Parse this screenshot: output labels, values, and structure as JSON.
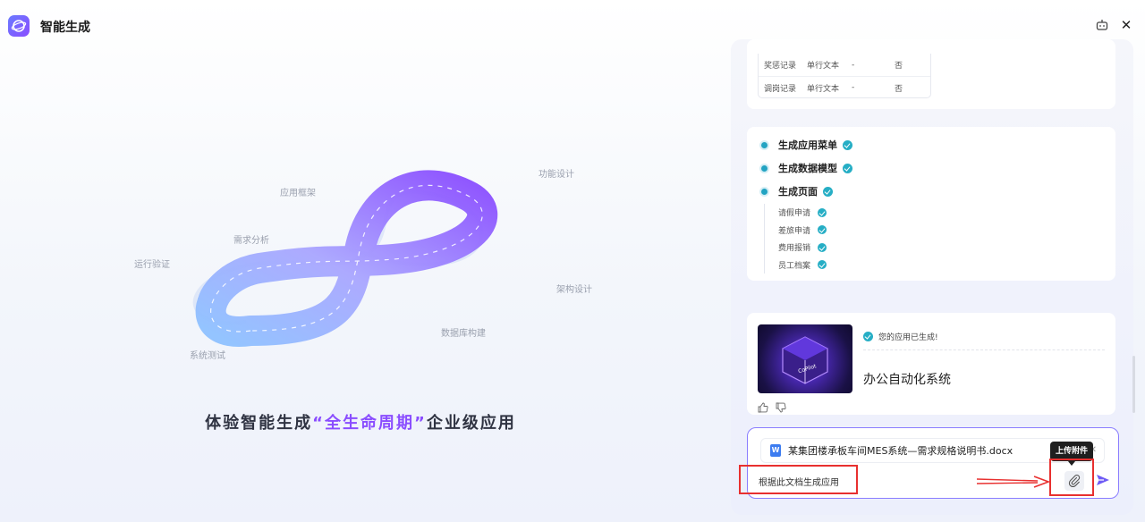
{
  "app": {
    "title": "智能生成"
  },
  "hero": {
    "caption_pre": "体验智能生成",
    "caption_highlight": "“全生命周期”",
    "caption_post": "企业级应用",
    "stages": {
      "design": "功能设计",
      "framework": "应用框架",
      "analysis": "需求分析",
      "verify": "运行验证",
      "arch": "架构设计",
      "db": "数据库构建",
      "test": "系统测试"
    }
  },
  "fields_table": {
    "rows": [
      {
        "name": "奖惩记录",
        "type": "单行文本",
        "default": "-",
        "required": "否"
      },
      {
        "name": "调岗记录",
        "type": "单行文本",
        "default": "-",
        "required": "否"
      }
    ]
  },
  "progress": {
    "steps": [
      "生成应用菜单",
      "生成数据模型",
      "生成页面"
    ],
    "pages": [
      "请假申请",
      "差旅申请",
      "费用报销",
      "员工档案"
    ]
  },
  "result": {
    "status": "您的应用已生成!",
    "app_name": "办公自动化系统",
    "thumb_text": "CoPilot"
  },
  "composer": {
    "attachment_name": "某集团楼承板车间MES系统—需求规格说明书.docx",
    "attachment_type": "W",
    "prompt": "根据此文档生成应用",
    "upload_tooltip": "上传附件"
  },
  "colors": {
    "accent": "#8a4dff",
    "check": "#26aec5",
    "annotation": "#e8302f"
  }
}
